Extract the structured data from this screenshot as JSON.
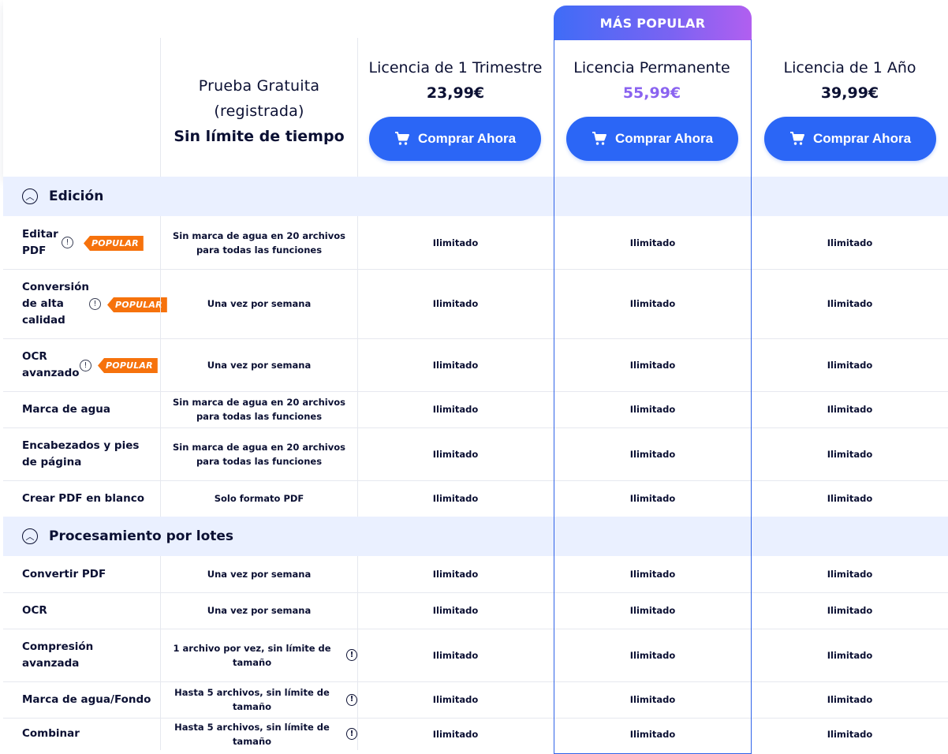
{
  "header": {
    "trial": {
      "line1": "Prueba Gratuita",
      "line2": "(registrada)",
      "line3": "Sin límite de tiempo"
    },
    "plans": [
      {
        "title": "Licencia de 1 Trimestre",
        "price": "23,99€",
        "button": "Comprar Ahora"
      },
      {
        "title": "Licencia Permanente",
        "price": "55,99€",
        "button": "Comprar Ahora",
        "tag": "MÁS POPULAR"
      },
      {
        "title": "Licencia de 1 Año",
        "price": "39,99€",
        "button": "Comprar Ahora"
      }
    ]
  },
  "badge_label": "POPULAR",
  "sections": [
    {
      "label": "Edición",
      "rows": [
        {
          "feature": "Editar PDF",
          "trial": "Sin marca de agua en 20 archivos para todas las funciones",
          "q": "Ilimitado",
          "perm": "Ilimitado",
          "year": "Ilimitado"
        },
        {
          "feature": "Conversión de alta calidad",
          "trial": "Una vez por semana",
          "q": "Ilimitado",
          "perm": "Ilimitado",
          "year": "Ilimitado"
        },
        {
          "feature": "OCR avanzado",
          "trial": "Una vez por semana",
          "q": "Ilimitado",
          "perm": "Ilimitado",
          "year": "Ilimitado"
        },
        {
          "feature": "Marca de agua",
          "trial": "Sin marca de agua en 20 archivos para todas las funciones",
          "q": "Ilimitado",
          "perm": "Ilimitado",
          "year": "Ilimitado"
        },
        {
          "feature": "Encabezados y pies de página",
          "trial": "Sin marca de agua en 20 archivos para todas las funciones",
          "q": "Ilimitado",
          "perm": "Ilimitado",
          "year": "Ilimitado"
        },
        {
          "feature": "Crear PDF en blanco",
          "trial": "Solo formato PDF",
          "q": "Ilimitado",
          "perm": "Ilimitado",
          "year": "Ilimitado"
        }
      ]
    },
    {
      "label": "Procesamiento por lotes",
      "rows": [
        {
          "feature": "Convertir PDF",
          "trial": "Una vez por semana",
          "q": "Ilimitado",
          "perm": "Ilimitado",
          "year": "Ilimitado"
        },
        {
          "feature": "OCR",
          "trial": "Una vez por semana",
          "q": "Ilimitado",
          "perm": "Ilimitado",
          "year": "Ilimitado"
        },
        {
          "feature": "Compresión avanzada",
          "trial": "1 archivo por vez, sin límite de tamaño",
          "q": "Ilimitado",
          "perm": "Ilimitado",
          "year": "Ilimitado"
        },
        {
          "feature": "Marca de agua/Fondo",
          "trial": "Hasta 5 archivos, sin límite de tamaño",
          "q": "Ilimitado",
          "perm": "Ilimitado",
          "year": "Ilimitado"
        },
        {
          "feature": "Combinar",
          "trial": "Hasta 5 archivos, sin límite de tamaño",
          "q": "Ilimitado",
          "perm": "Ilimitado",
          "year": "Ilimitado"
        }
      ]
    }
  ],
  "colors": {
    "primary": "#2b66f6",
    "accent_price": "#8a63f0",
    "badge": "#f6720c",
    "section_bg": "#eaf0ff"
  }
}
